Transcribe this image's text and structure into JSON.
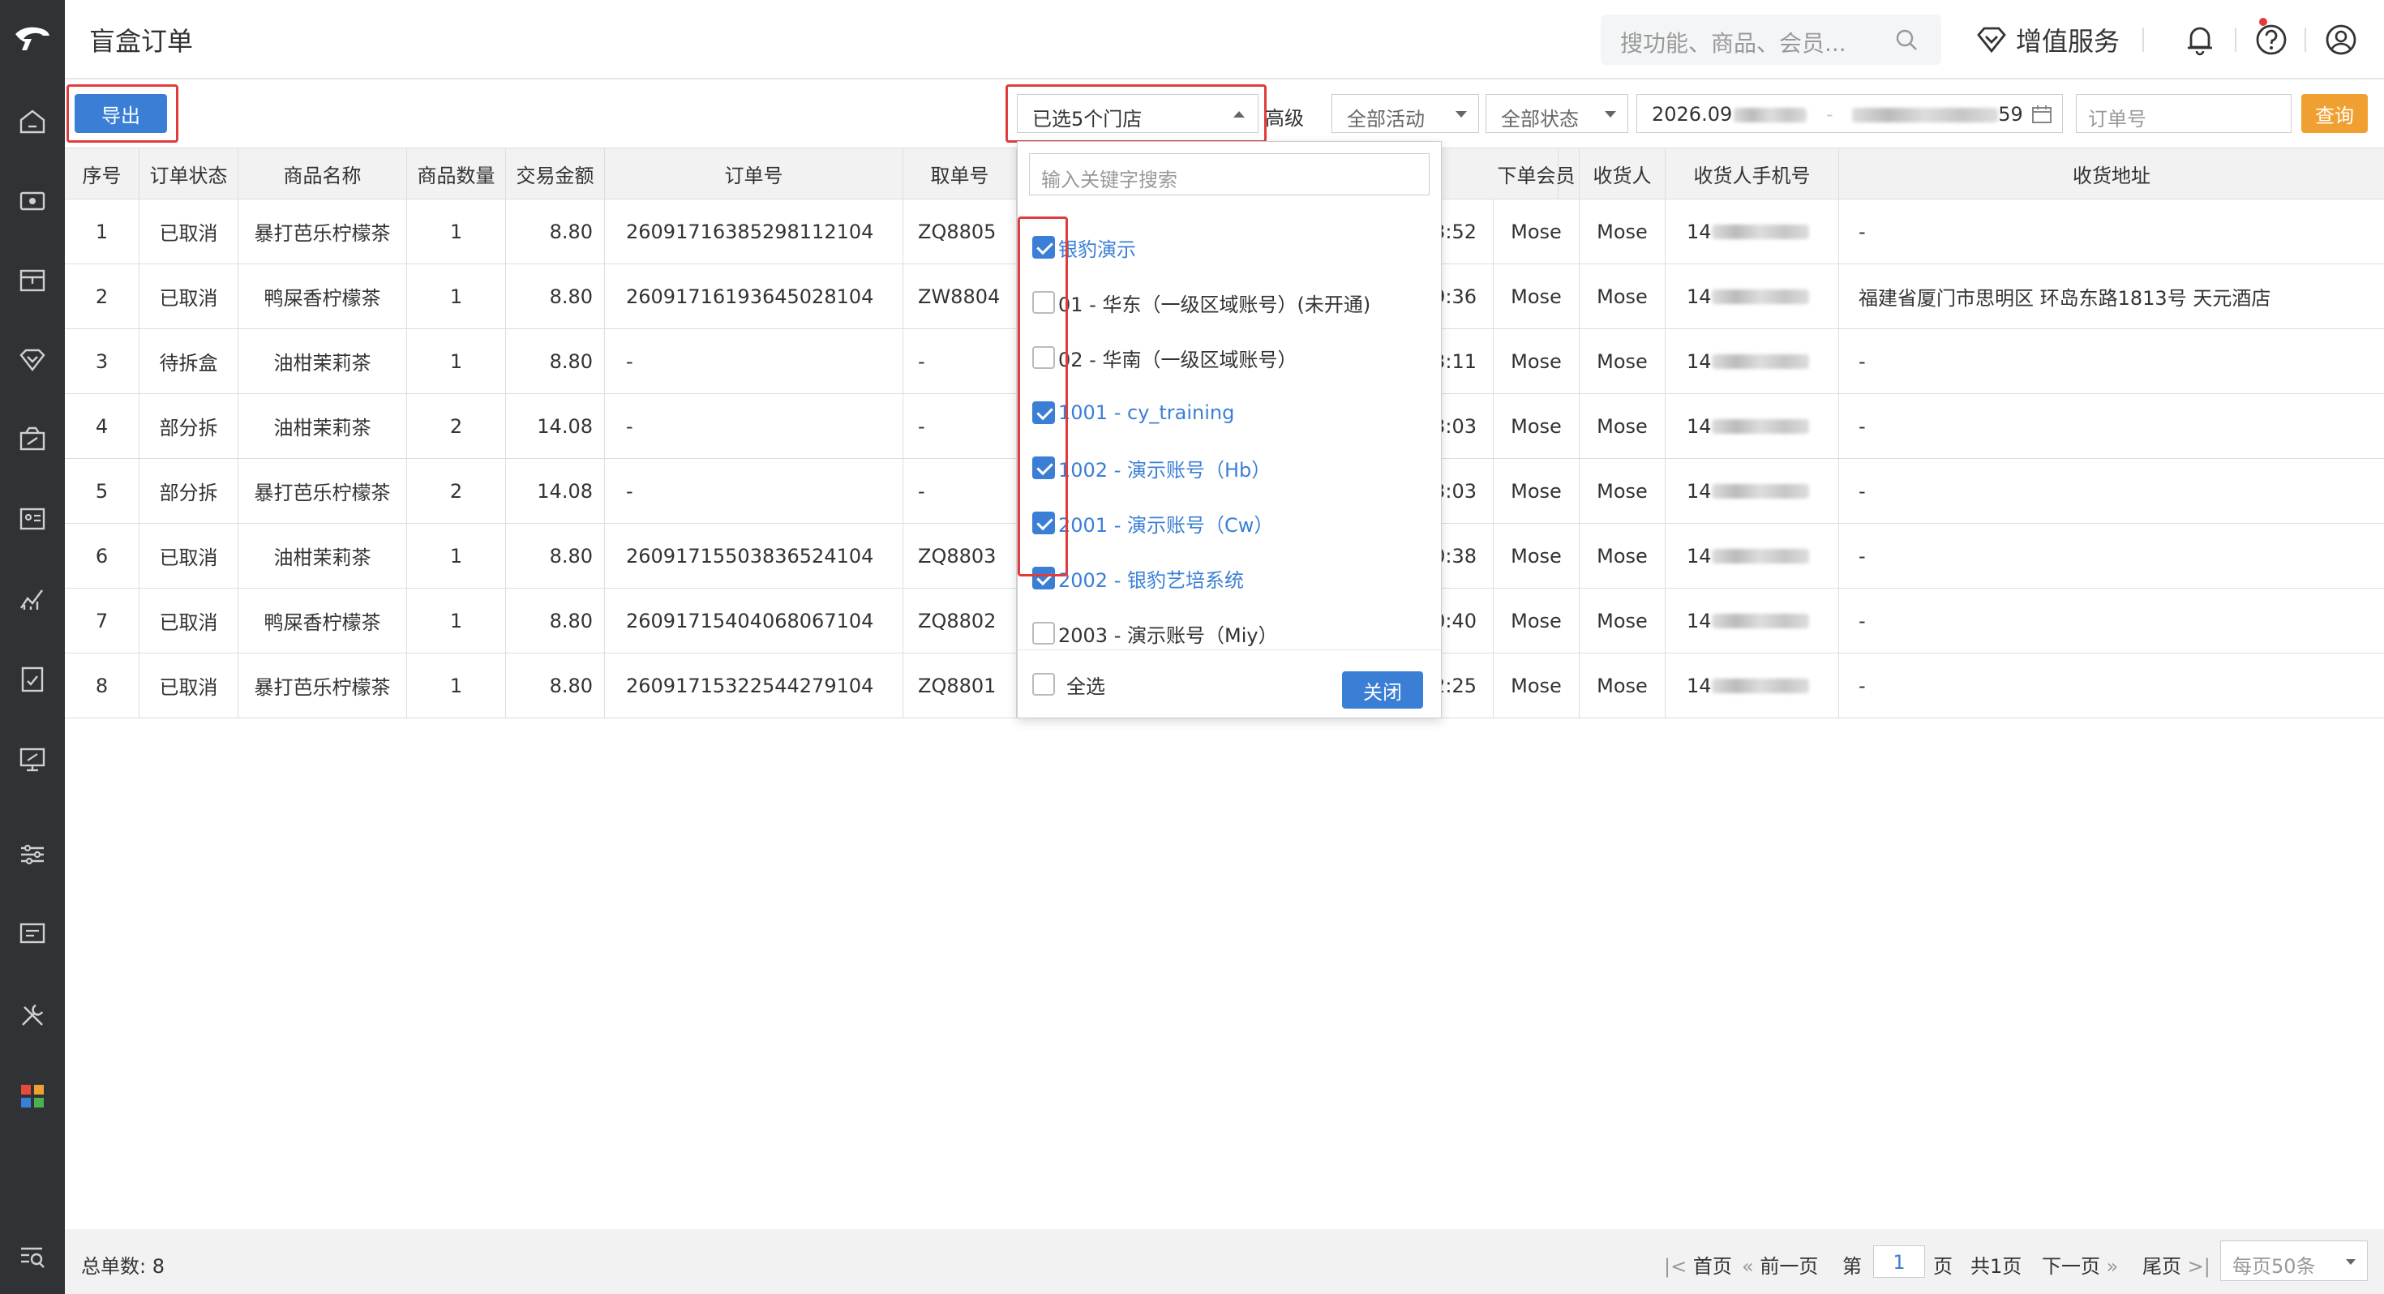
{
  "header": {
    "title": "盲盒订单",
    "search_placeholder": "搜功能、商品、会员...",
    "value_added_service": "增值服务"
  },
  "toolbar": {
    "export_label": "导出",
    "store_select_value": "已选5个门店",
    "advanced_label": "高级",
    "activity_select": "全部活动",
    "status_select": "全部状态",
    "date_start": "2026.09",
    "date_end_suffix": "59",
    "order_placeholder": "订单号",
    "query_label": "查询"
  },
  "table": {
    "headers": [
      "序号",
      "订单状态",
      "商品名称",
      "商品数量",
      "交易金额",
      "订单号",
      "取单号",
      "下单会员",
      "收货人",
      "收货人手机号",
      "收货地址"
    ],
    "rows": [
      {
        "no": "1",
        "status": "已取消",
        "product": "暴打芭乐柠檬茶",
        "qty": "1",
        "amount": "8.80",
        "order_no": "26091716385298112104",
        "pickup": "ZQ8805",
        "time": "3:52",
        "member": "Mose",
        "receiver": "Mose",
        "phone": "14",
        "address": "-"
      },
      {
        "no": "2",
        "status": "已取消",
        "product": "鸭屎香柠檬茶",
        "qty": "1",
        "amount": "8.80",
        "order_no": "26091716193645028104",
        "pickup": "ZW8804",
        "time": "9:36",
        "member": "Mose",
        "receiver": "Mose",
        "phone": "14",
        "address": "福建省厦门市思明区 环岛东路1813号 天元酒店"
      },
      {
        "no": "3",
        "status": "待拆盒",
        "product": "油柑茉莉茶",
        "qty": "1",
        "amount": "8.80",
        "order_no": "-",
        "pickup": "-",
        "time": "3:11",
        "member": "Mose",
        "receiver": "Mose",
        "phone": "14",
        "address": "-"
      },
      {
        "no": "4",
        "status": "部分拆",
        "product": "油柑茉莉茶",
        "qty": "2",
        "amount": "14.08",
        "order_no": "-",
        "pickup": "-",
        "time": "3:03",
        "member": "Mose",
        "receiver": "Mose",
        "phone": "14",
        "address": "-"
      },
      {
        "no": "5",
        "status": "部分拆",
        "product": "暴打芭乐柠檬茶",
        "qty": "2",
        "amount": "14.08",
        "order_no": "-",
        "pickup": "-",
        "time": "3:03",
        "member": "Mose",
        "receiver": "Mose",
        "phone": "14",
        "address": "-"
      },
      {
        "no": "6",
        "status": "已取消",
        "product": "油柑茉莉茶",
        "qty": "1",
        "amount": "8.80",
        "order_no": "26091715503836524104",
        "pickup": "ZQ8803",
        "time": "0:38",
        "member": "Mose",
        "receiver": "Mose",
        "phone": "14",
        "address": "-"
      },
      {
        "no": "7",
        "status": "已取消",
        "product": "鸭屎香柠檬茶",
        "qty": "1",
        "amount": "8.80",
        "order_no": "26091715404068067104",
        "pickup": "ZQ8802",
        "time": "0:40",
        "member": "Mose",
        "receiver": "Mose",
        "phone": "14",
        "address": "-"
      },
      {
        "no": "8",
        "status": "已取消",
        "product": "暴打芭乐柠檬茶",
        "qty": "1",
        "amount": "8.80",
        "order_no": "26091715322544279104",
        "pickup": "ZQ8801",
        "time": "2:25",
        "member": "Mose",
        "receiver": "Mose",
        "phone": "14",
        "address": "-"
      }
    ]
  },
  "dropdown": {
    "search_placeholder": "输入关键字搜索",
    "items": [
      {
        "label": "银豹演示",
        "checked": true
      },
      {
        "label": "01 - 华东（一级区域账号）(未开通)",
        "checked": false
      },
      {
        "label": "02 - 华南（一级区域账号）",
        "checked": false
      },
      {
        "label": "1001 - cy_training",
        "checked": true
      },
      {
        "label": "1002 - 演示账号（Hb）",
        "checked": true
      },
      {
        "label": "2001 - 演示账号（Cw）",
        "checked": true
      },
      {
        "label": "2002 - 银豹艺培系统",
        "checked": true
      },
      {
        "label": "2003 - 演示账号（Miy）",
        "checked": false
      }
    ],
    "select_all": "全选",
    "close_label": "关闭"
  },
  "footer": {
    "total_label": "总单数:",
    "total_value": "8",
    "first": "首页",
    "prev": "前一页",
    "page_prefix": "第",
    "page_value": "1",
    "page_suffix": "页",
    "total_pages": "共1页",
    "next": "下一页",
    "last": "尾页",
    "per_page": "每页50条"
  },
  "colors": {
    "primary": "#3a7fd5",
    "query": "#f0a030",
    "highlight": "#e03c3c",
    "sidebar": "#2f3336"
  }
}
